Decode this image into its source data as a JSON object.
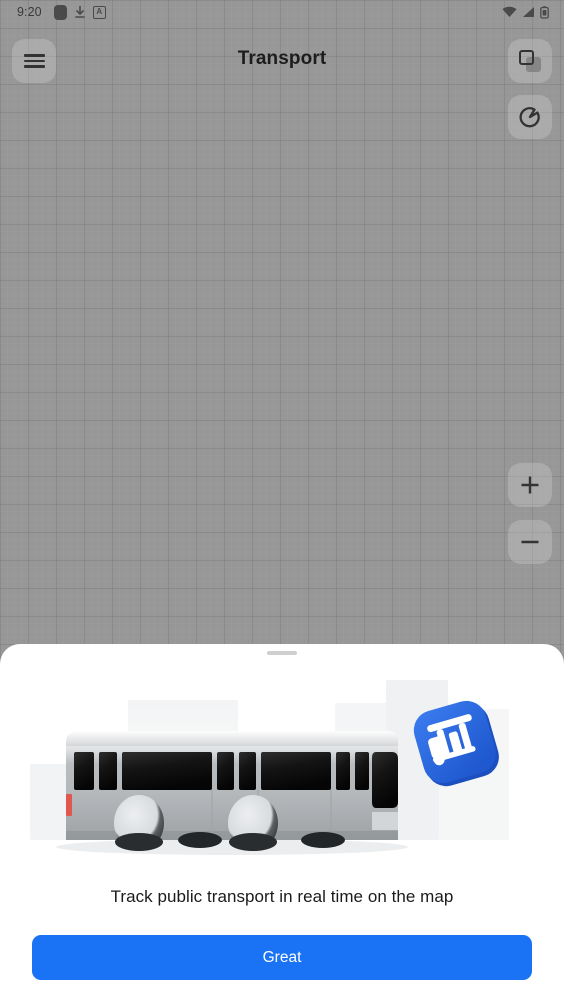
{
  "statusbar": {
    "time": "9:20",
    "left_icons": [
      {
        "name": "rounded-square-icon",
        "glyph": "rounded-square"
      },
      {
        "name": "download-icon",
        "glyph": "download"
      },
      {
        "name": "boxed-a-icon",
        "glyph": "A"
      }
    ],
    "right_icons": [
      {
        "name": "wifi-icon",
        "glyph": "wifi"
      },
      {
        "name": "cell-signal-icon",
        "glyph": "signal"
      },
      {
        "name": "battery-icon",
        "glyph": "battery"
      }
    ]
  },
  "appbar": {
    "title": "Transport",
    "menu_icon": "hamburger-menu-icon",
    "layers_icon": "map-layers-icon"
  },
  "map_controls": {
    "compass_icon": "compass-icon",
    "zoom_in_label": "+",
    "zoom_out_label": "−"
  },
  "sheet": {
    "handle": "drag-handle",
    "illustration": {
      "name": "bus-illustration",
      "badge_glyph": "transit-badge",
      "badge_color": "#2f6fe4"
    },
    "caption": "Track public transport in real time on the map",
    "cta_label": "Great"
  },
  "colors": {
    "accent": "#1a73f5",
    "sheet_bg": "#ffffff",
    "map_bg": "#979797",
    "text_primary": "#1b1b1b"
  }
}
